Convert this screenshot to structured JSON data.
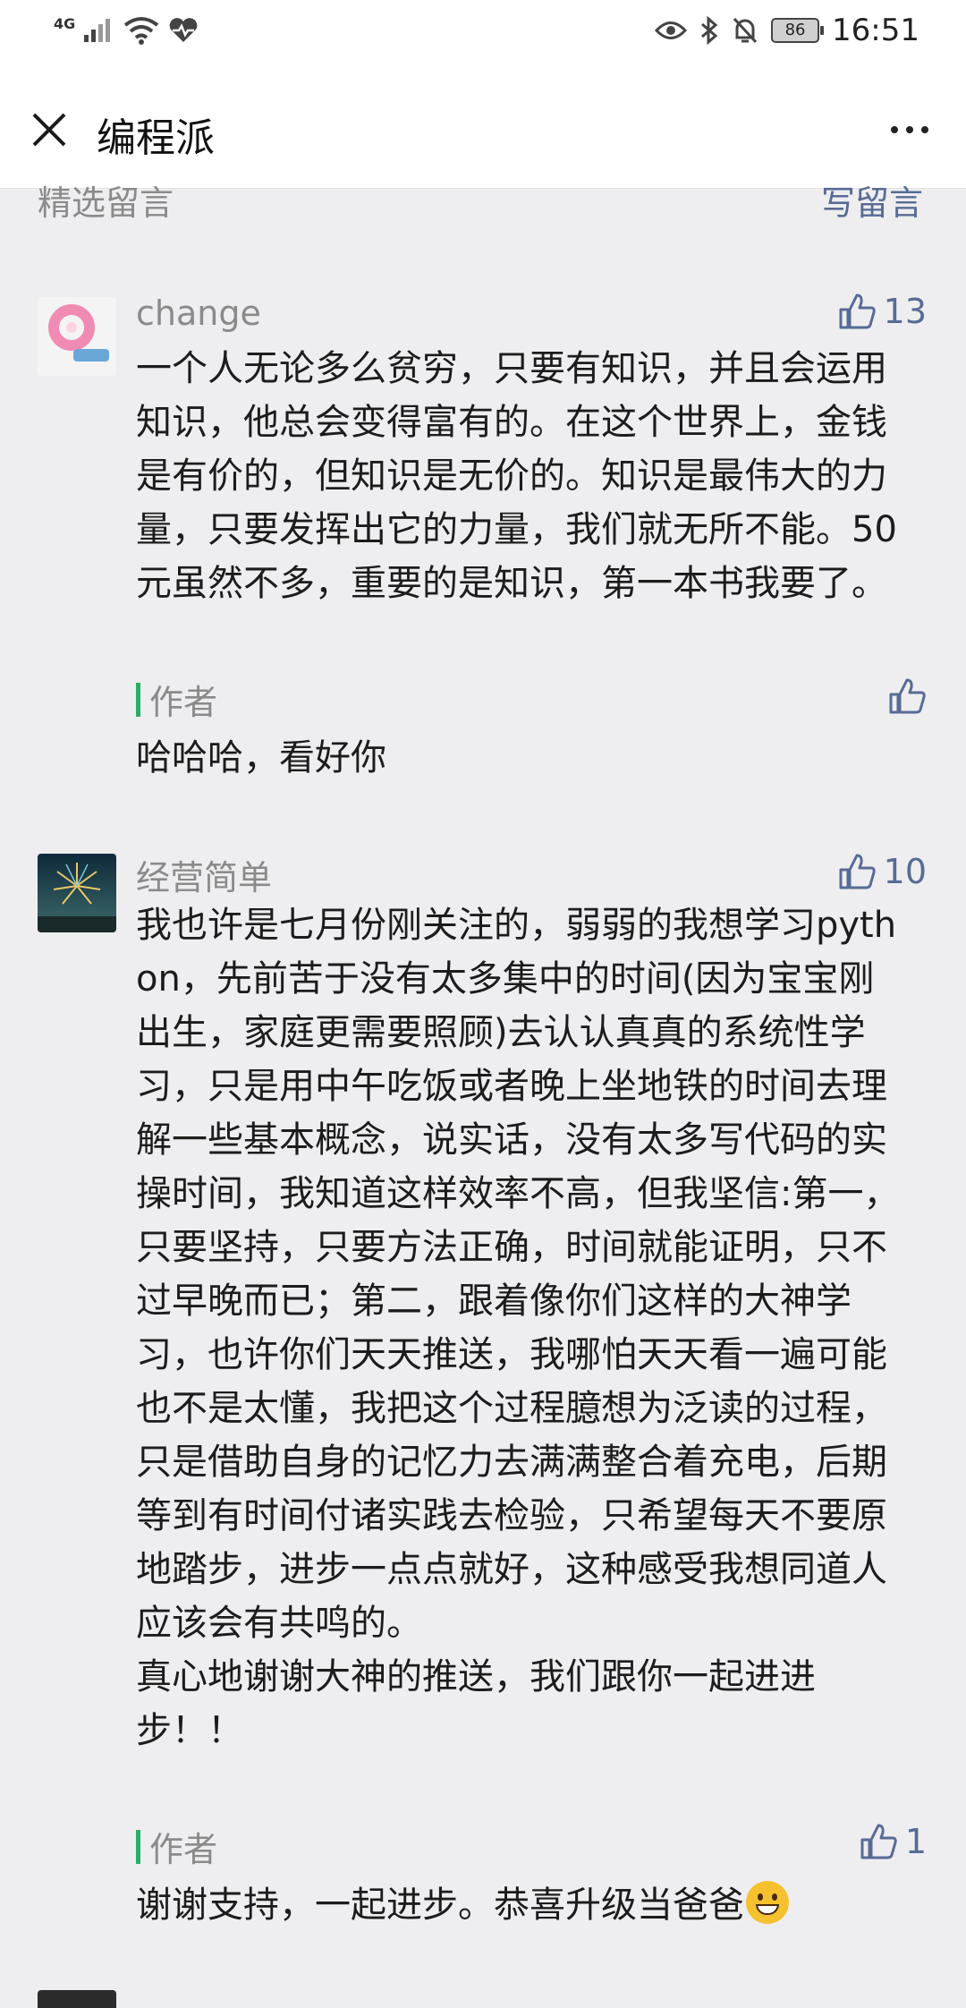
{
  "status_bar": {
    "network": "4G",
    "battery": "86",
    "time": "16:51"
  },
  "header": {
    "title": "编程派"
  },
  "section": {
    "left_label": "精选留言",
    "right_label": "写留言"
  },
  "comments": [
    {
      "user": "change",
      "likes": "13",
      "text": "一个人无论多么贫穷，只要有知识，并且会运用知识，他总会变得富有的。在这个世界上，金钱是有价的，但知识是无价的。知识是最伟大的力量，只要发挥出它的力量，我们就无所不能。50元虽然不多，重要的是知识，第一本书我要了。",
      "author_label": "作者",
      "reply": "哈哈哈，看好你",
      "reply_likes": ""
    },
    {
      "user": "经营简单",
      "likes": "10",
      "text": "我也许是七月份刚关注的，弱弱的我想学习python，先前苦于没有太多集中的时间(因为宝宝刚出生，家庭更需要照顾)去认认真真的系统性学习，只是用中午吃饭或者晚上坐地铁的时间去理解一些基本概念，说实话，没有太多写代码的实操时间，我知道这样效率不高，但我坚信:第一，只要坚持，只要方法正确，时间就能证明，只不过早晚而已；第二，跟着像你们这样的大神学习，也许你们天天推送，我哪怕天天看一遍可能也不是太懂，我把这个过程臆想为泛读的过程，只是借助自身的记忆力去满满整合着充电，后期等到有时间付诸实践去检验，只希望每天不要原地踏步，进步一点点就好，这种感受我想同道人应该会有共鸣的。\n真心地谢谢大神的推送，我们跟你一起进进步！！",
      "author_label": "作者",
      "reply": "谢谢支持，一起进步。恭喜升级当爸爸",
      "reply_likes": "1"
    }
  ]
}
